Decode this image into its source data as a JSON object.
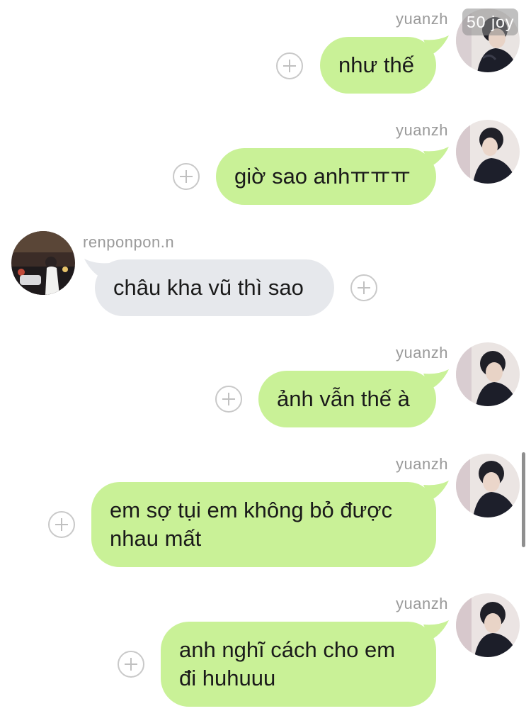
{
  "conversation": {
    "badge": "50 joy",
    "messages": [
      {
        "sender": "yuanzh",
        "text": "như thế"
      },
      {
        "sender": "yuanzh",
        "text": "giờ sao anhㅠㅠㅠ"
      },
      {
        "sender": "renponpon.n",
        "text": "châu kha vũ thì sao"
      },
      {
        "sender": "yuanzh",
        "text": "ảnh vẫn thế à"
      },
      {
        "sender": "yuanzh",
        "text": "em sợ tụi em không bỏ được nhau mất"
      },
      {
        "sender": "yuanzh",
        "text": "anh nghĩ cách cho em đi huhuuu"
      }
    ]
  },
  "colors": {
    "my_bubble": "#c9f197",
    "their_bubble": "#e6e8ec",
    "sender_name": "#9a9a9a"
  },
  "icons": {
    "add": "plus-circle-icon"
  }
}
